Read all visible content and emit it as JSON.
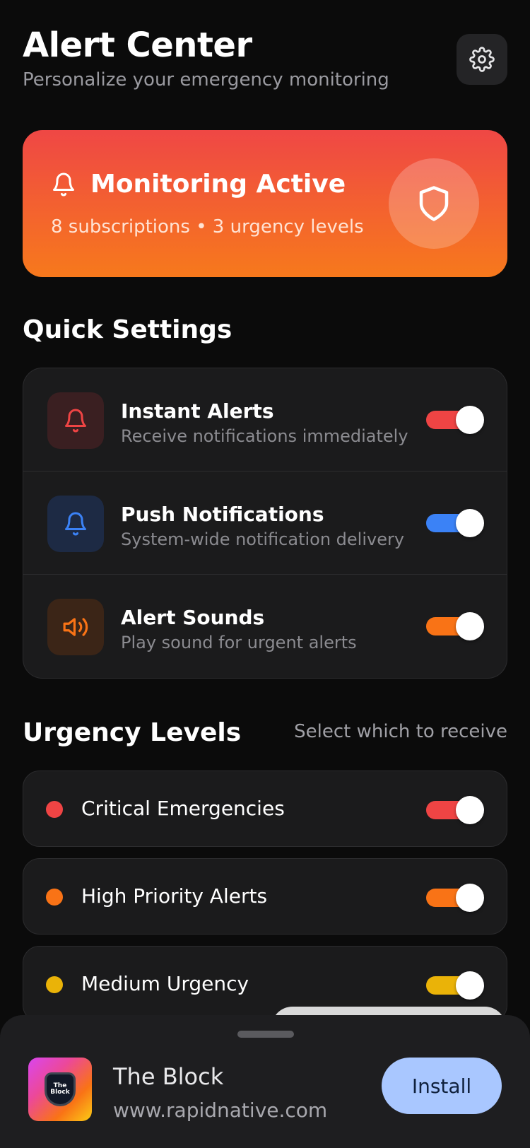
{
  "header": {
    "title": "Alert Center",
    "subtitle": "Personalize your emergency monitoring",
    "settings_icon": "gear-icon"
  },
  "hero": {
    "title": "Monitoring Active",
    "summary": "8 subscriptions • 3 urgency levels",
    "icon": "shield-icon",
    "colors": {
      "top": "#ef4745",
      "bottom": "#f7791c"
    }
  },
  "quick_settings": {
    "title": "Quick Settings",
    "items": [
      {
        "label": "Instant Alerts",
        "description": "Receive notifications immediately",
        "icon": "bell-icon",
        "enabled": true,
        "accent": "#ef4444",
        "icon_bg": "#3a1f21"
      },
      {
        "label": "Push Notifications",
        "description": "System-wide notification delivery",
        "icon": "bell-icon",
        "enabled": true,
        "accent": "#3b82f6",
        "icon_bg": "#1d2a44"
      },
      {
        "label": "Alert Sounds",
        "description": "Play sound for urgent alerts",
        "icon": "speaker-icon",
        "enabled": true,
        "accent": "#f97316",
        "icon_bg": "#3b2517"
      }
    ]
  },
  "urgency_levels": {
    "title": "Urgency Levels",
    "hint": "Select which to receive",
    "items": [
      {
        "label": "Critical Emergencies",
        "color": "#ef4444",
        "enabled": true
      },
      {
        "label": "High Priority Alerts",
        "color": "#f97316",
        "enabled": true
      },
      {
        "label": "Medium Urgency",
        "color": "#eab308",
        "enabled": true
      }
    ]
  },
  "install_sheet": {
    "app_name": "The Block",
    "app_url": "www.rapidnative.com",
    "install_label": "Install",
    "icon_text": "The Block"
  }
}
